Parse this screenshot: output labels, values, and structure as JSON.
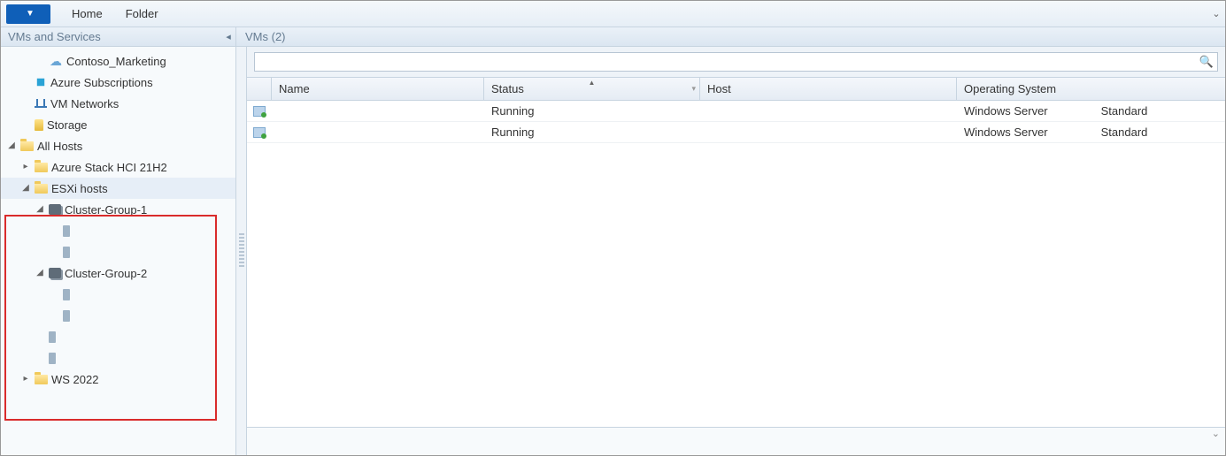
{
  "ribbon": {
    "tabs": [
      "Home",
      "Folder"
    ]
  },
  "panes": {
    "left_title": "VMs and Services",
    "right_title": "VMs (2)"
  },
  "sidebar": {
    "items": [
      {
        "label": "Contoso_Marketing",
        "icon": "cloud",
        "indent": 2,
        "expander": "none"
      },
      {
        "label": "Azure Subscriptions",
        "icon": "azure",
        "indent": 1,
        "expander": "none"
      },
      {
        "label": "VM Networks",
        "icon": "network",
        "indent": 1,
        "expander": "none"
      },
      {
        "label": "Storage",
        "icon": "storage",
        "indent": 1,
        "expander": "none"
      },
      {
        "label": "All Hosts",
        "icon": "folder",
        "indent": 0,
        "expander": "open"
      },
      {
        "label": "Azure Stack HCI 21H2",
        "icon": "folder",
        "indent": 1,
        "expander": "closed"
      },
      {
        "label": "ESXi hosts",
        "icon": "folder",
        "indent": 1,
        "expander": "open",
        "selected": true
      },
      {
        "label": "Cluster-Group-1",
        "icon": "cluster",
        "indent": 2,
        "expander": "open"
      },
      {
        "label": "",
        "icon": "host",
        "indent": 3,
        "expander": "none"
      },
      {
        "label": "",
        "icon": "host",
        "indent": 3,
        "expander": "none"
      },
      {
        "label": "Cluster-Group-2",
        "icon": "cluster",
        "indent": 2,
        "expander": "open"
      },
      {
        "label": "",
        "icon": "host",
        "indent": 3,
        "expander": "none"
      },
      {
        "label": "",
        "icon": "host",
        "indent": 3,
        "expander": "none"
      },
      {
        "label": "",
        "icon": "host",
        "indent": 2,
        "expander": "none"
      },
      {
        "label": "",
        "icon": "host",
        "indent": 2,
        "expander": "none"
      },
      {
        "label": "WS 2022",
        "icon": "folder",
        "indent": 1,
        "expander": "closed"
      }
    ]
  },
  "search": {
    "placeholder": ""
  },
  "grid": {
    "columns": {
      "name": "Name",
      "status": "Status",
      "host": "Host",
      "os": "Operating System"
    },
    "rows": [
      {
        "name": "",
        "status": "Running",
        "host": "",
        "os": "Windows Server",
        "os_extra": "Standard"
      },
      {
        "name": "",
        "status": "Running",
        "host": "",
        "os": "Windows Server",
        "os_extra": "Standard"
      }
    ]
  }
}
